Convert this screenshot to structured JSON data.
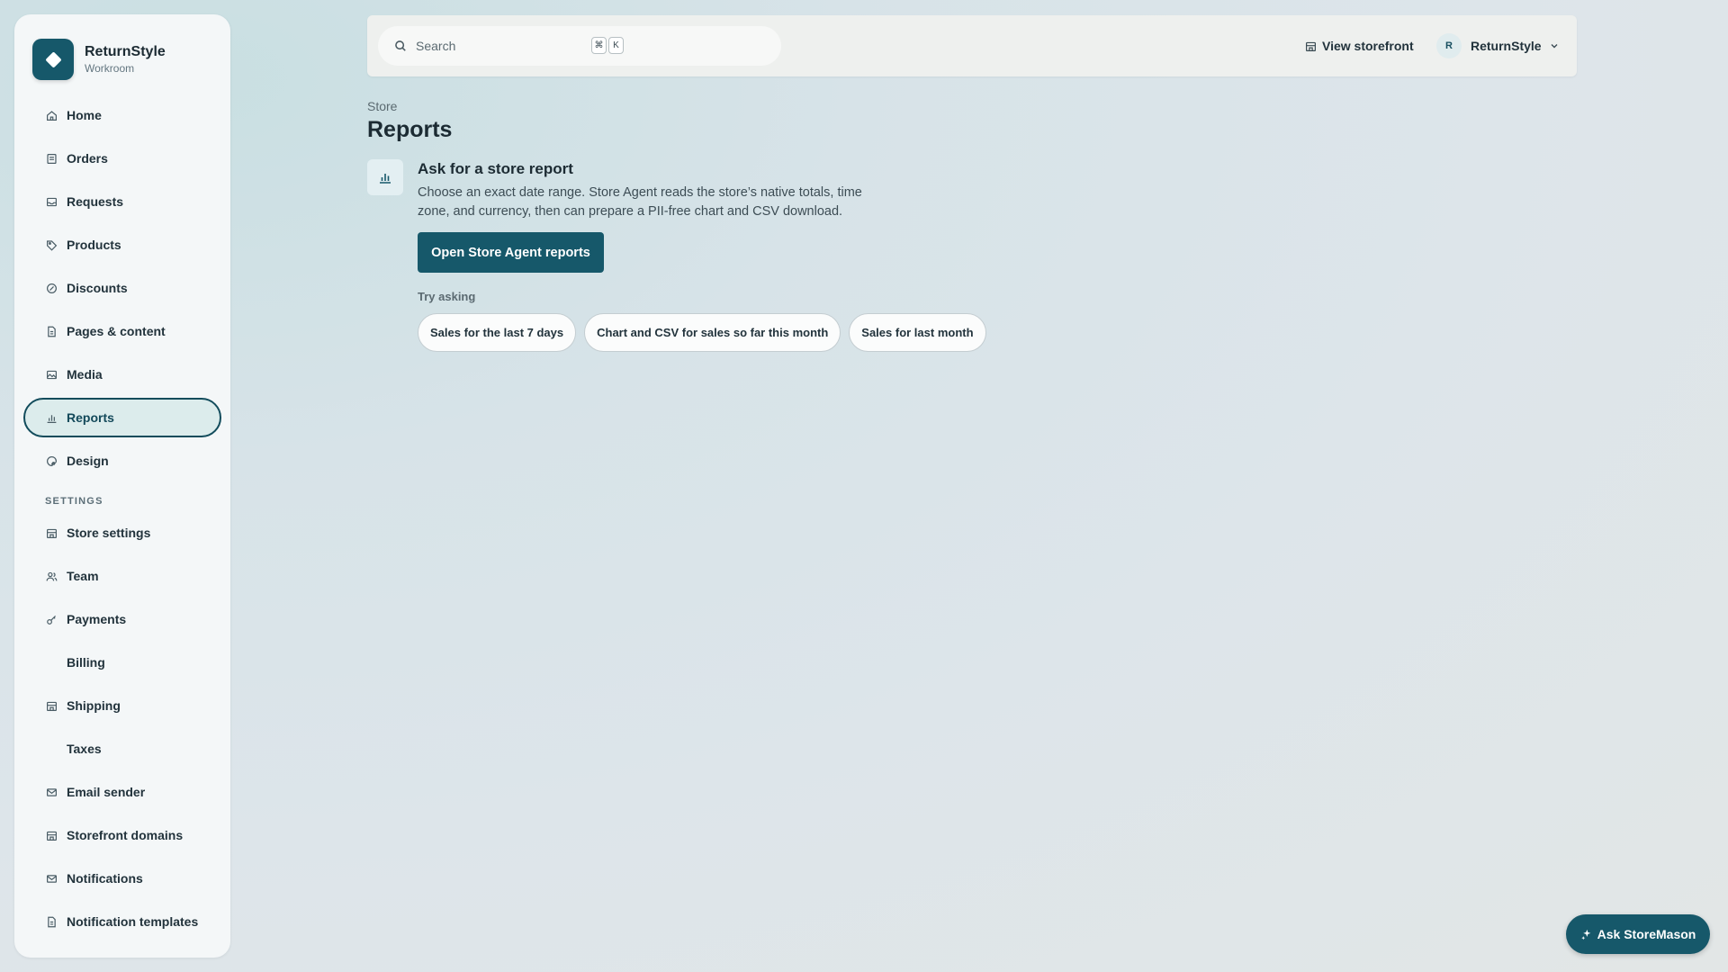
{
  "brand": {
    "name": "ReturnStyle",
    "subtitle": "Workroom",
    "logo_icon": "diamond-icon"
  },
  "sidebar": {
    "items": [
      {
        "label": "Home",
        "icon": "home-icon"
      },
      {
        "label": "Orders",
        "icon": "orders-icon"
      },
      {
        "label": "Requests",
        "icon": "inbox-icon"
      },
      {
        "label": "Products",
        "icon": "tag-icon"
      },
      {
        "label": "Discounts",
        "icon": "discount-icon"
      },
      {
        "label": "Pages & content",
        "icon": "page-icon"
      },
      {
        "label": "Media",
        "icon": "image-icon"
      },
      {
        "label": "Reports",
        "icon": "bar-chart-icon",
        "active": true
      },
      {
        "label": "Design",
        "icon": "palette-icon"
      }
    ],
    "settings_label": "SETTINGS",
    "settings_items": [
      {
        "label": "Store settings",
        "icon": "store-icon"
      },
      {
        "label": "Team",
        "icon": "team-icon"
      },
      {
        "label": "Payments",
        "icon": "key-icon"
      },
      {
        "label": "Billing",
        "icon": ""
      },
      {
        "label": "Shipping",
        "icon": "store-icon"
      },
      {
        "label": "Taxes",
        "icon": ""
      },
      {
        "label": "Email sender",
        "icon": "mail-icon"
      },
      {
        "label": "Storefront domains",
        "icon": "store-icon"
      },
      {
        "label": "Notifications",
        "icon": "mail-icon"
      },
      {
        "label": "Notification templates",
        "icon": "page-icon"
      }
    ]
  },
  "topbar": {
    "search_placeholder": "Search",
    "shortcut_keys": [
      "⌘",
      "K"
    ],
    "view_storefront": "View storefront",
    "account_initial": "R",
    "account_name": "ReturnStyle"
  },
  "main": {
    "breadcrumb": "Store",
    "title": "Reports",
    "card": {
      "title": "Ask for a store report",
      "description": "Choose an exact date range. Store Agent reads the store’s native totals, time zone, and currency, then can prepare a PII-free chart and CSV download.",
      "button": "Open Store Agent reports"
    },
    "try_label": "Try asking",
    "suggestions": [
      "Sales for the last 7 days",
      "Chart and CSV for sales so far this month",
      "Sales for last month"
    ]
  },
  "fab": {
    "label": "Ask StoreMason",
    "icon": "sparkle-icon"
  },
  "colors": {
    "accent": "#16586a",
    "active_bg": "#dcecec"
  }
}
